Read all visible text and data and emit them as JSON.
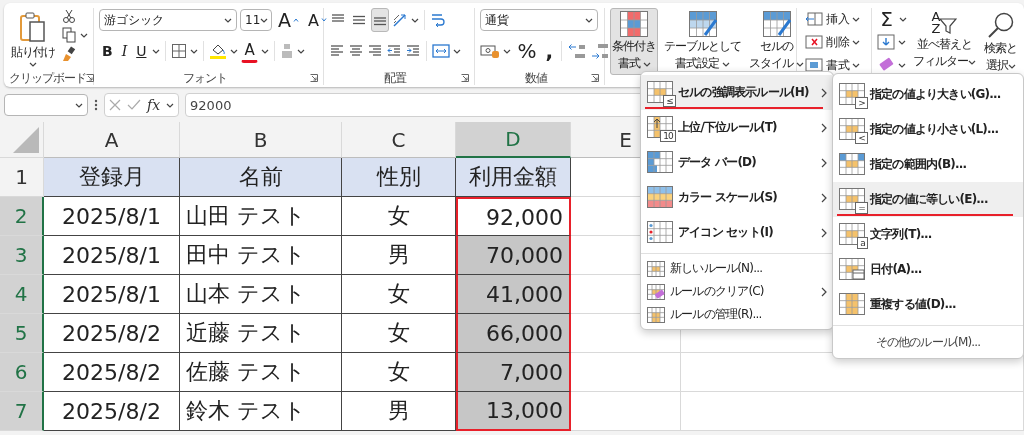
{
  "ribbon": {
    "clipboard": {
      "paste": "貼り付け",
      "label": "クリップボード"
    },
    "font": {
      "name": "游ゴシック",
      "size": "11",
      "grow": "A",
      "shrink": "A",
      "bold": "B",
      "italic": "I",
      "underline": "U",
      "color_letter": "A",
      "label": "フォント"
    },
    "alignment": {
      "vertical": [
        {
          "kind": "top",
          "pressed": false
        },
        {
          "kind": "middle",
          "pressed": false
        },
        {
          "kind": "bottom",
          "pressed": true
        }
      ],
      "label": "配置"
    },
    "number": {
      "format": "通貨",
      "percent": "%",
      "comma": ",",
      "label": "数値"
    },
    "styles": [
      {
        "lines": [
          "条件付き",
          "書式"
        ],
        "pressed": true
      },
      {
        "lines": [
          "テーブルとして",
          "書式設定"
        ],
        "pressed": false
      },
      {
        "lines": [
          "セルの",
          "スタイル"
        ],
        "pressed": false
      }
    ],
    "cells": [
      {
        "label": "挿入"
      },
      {
        "label": "削除"
      },
      {
        "label": "書式"
      }
    ],
    "editing": {
      "sum": "Σ",
      "sort_letters": [
        "A",
        "Z"
      ],
      "sort": [
        "並べ替えと",
        "フィルター"
      ],
      "find": [
        "検索と",
        "選択"
      ]
    }
  },
  "formula_bar": {
    "fx": "fx",
    "formula": "92000"
  },
  "sheet": {
    "columns": [
      {
        "label": "A",
        "selected": false
      },
      {
        "label": "B",
        "selected": false
      },
      {
        "label": "C",
        "selected": false
      },
      {
        "label": "D",
        "selected": true
      },
      {
        "label": "E",
        "selected": false
      }
    ],
    "rows": [
      {
        "number": "1",
        "kind": "header",
        "selected": false,
        "active": false,
        "cells": [
          "登録月",
          "名前",
          "性別",
          "利用金額"
        ]
      },
      {
        "number": "2",
        "kind": "data",
        "selected": true,
        "active": true,
        "cells": [
          "2025/8/1",
          "山田 テスト",
          "女",
          "92,000"
        ]
      },
      {
        "number": "3",
        "kind": "data",
        "selected": true,
        "active": false,
        "cells": [
          "2025/8/1",
          "田中 テスト",
          "男",
          "70,000"
        ]
      },
      {
        "number": "4",
        "kind": "data",
        "selected": true,
        "active": false,
        "cells": [
          "2025/8/1",
          "山本 テスト",
          "女",
          "41,000"
        ]
      },
      {
        "number": "5",
        "kind": "data",
        "selected": true,
        "active": false,
        "cells": [
          "2025/8/2",
          "近藤 テスト",
          "女",
          "66,000"
        ]
      },
      {
        "number": "6",
        "kind": "data",
        "selected": true,
        "active": false,
        "cells": [
          "2025/8/2",
          "佐藤 テスト",
          "女",
          "7,000"
        ]
      },
      {
        "number": "7",
        "kind": "data",
        "selected": true,
        "active": false,
        "cells": [
          "2025/8/2",
          "鈴木 テスト",
          "男",
          "13,000"
        ]
      }
    ]
  },
  "conditional_menu": {
    "items": [
      {
        "kind": "rule",
        "label": "セルの強調表示ルール(H)",
        "badge": "≤",
        "submenu": true,
        "selected": true
      },
      {
        "kind": "rule",
        "label": "上位/下位ルール(T)",
        "badge": "10",
        "submenu": true,
        "selected": false
      },
      {
        "kind": "rule",
        "label": "データ バー(D)",
        "submenu": true,
        "selected": false
      },
      {
        "kind": "rule",
        "label": "カラー スケール(S)",
        "submenu": true,
        "selected": false
      },
      {
        "kind": "rule",
        "label": "アイコン セット(I)",
        "submenu": true,
        "selected": false
      },
      {
        "kind": "command",
        "label": "新しいルール(N)...",
        "submenu": false,
        "selected": false
      },
      {
        "kind": "command",
        "label": "ルールのクリア(C)",
        "submenu": true,
        "selected": false
      },
      {
        "kind": "command",
        "label": "ルールの管理(R)...",
        "submenu": false,
        "selected": false
      }
    ]
  },
  "rule_submenu": {
    "items": [
      {
        "label": "指定の値より大きい(G)...",
        "badge": ">",
        "selected": false
      },
      {
        "label": "指定の値より小さい(L)...",
        "badge": "<",
        "selected": false
      },
      {
        "label": "指定の範囲内(B)...",
        "selected": false
      },
      {
        "label": "指定の値に等しい(E)...",
        "badge": "=",
        "selected": true
      },
      {
        "label": "文字列(T)...",
        "badge": "a",
        "selected": false
      },
      {
        "label": "日付(A)...",
        "selected": false
      },
      {
        "label": "重複する値(D)...",
        "selected": false
      }
    ],
    "more": "その他のルール(M)..."
  }
}
